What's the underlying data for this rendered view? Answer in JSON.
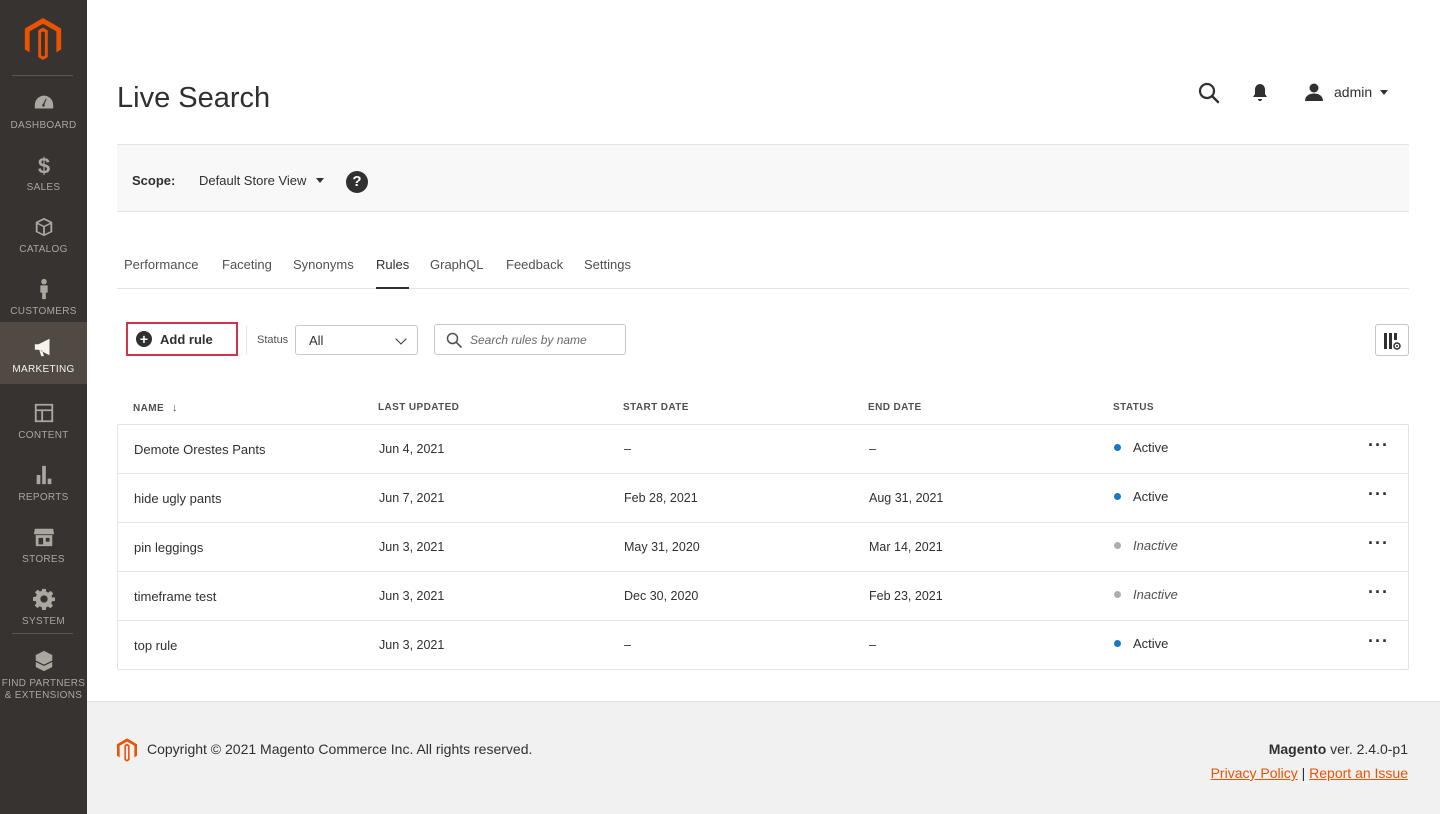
{
  "sidebar": {
    "logo": "magento-logo",
    "items": [
      {
        "label": "DASHBOARD",
        "icon": "dashboard-icon"
      },
      {
        "label": "SALES",
        "icon": "dollar-icon"
      },
      {
        "label": "CATALOG",
        "icon": "box-icon"
      },
      {
        "label": "CUSTOMERS",
        "icon": "person-icon"
      },
      {
        "label": "MARKETING",
        "icon": "megaphone-icon",
        "active": true
      },
      {
        "label": "CONTENT",
        "icon": "layout-icon"
      },
      {
        "label": "REPORTS",
        "icon": "bar-chart-icon"
      },
      {
        "label": "STORES",
        "icon": "storefront-icon"
      },
      {
        "label": "SYSTEM",
        "icon": "gear-icon"
      },
      {
        "label": "FIND PARTNERS",
        "label2": "& EXTENSIONS",
        "icon": "extensions-icon"
      }
    ]
  },
  "header": {
    "title": "Live Search",
    "user": "admin"
  },
  "scope": {
    "label": "Scope:",
    "value": "Default Store View",
    "help": "?"
  },
  "tabs": [
    {
      "label": "Performance"
    },
    {
      "label": "Faceting"
    },
    {
      "label": "Synonyms"
    },
    {
      "label": "Rules",
      "active": true
    },
    {
      "label": "GraphQL"
    },
    {
      "label": "Feedback"
    },
    {
      "label": "Settings"
    }
  ],
  "toolbar": {
    "add_rule": "Add rule",
    "status_label": "Status",
    "status_value": "All",
    "search_placeholder": "Search rules by name"
  },
  "table": {
    "columns": [
      "NAME",
      "LAST UPDATED",
      "START DATE",
      "END DATE",
      "STATUS"
    ],
    "rows": [
      {
        "name": "Demote Orestes Pants",
        "updated": "Jun 4, 2021",
        "start": "–",
        "end": "–",
        "status": "Active"
      },
      {
        "name": "hide ugly pants",
        "updated": "Jun 7, 2021",
        "start": "Feb 28, 2021",
        "end": "Aug 31, 2021",
        "status": "Active"
      },
      {
        "name": "pin leggings",
        "updated": "Jun 3, 2021",
        "start": "May 31, 2020",
        "end": "Mar 14, 2021",
        "status": "Inactive"
      },
      {
        "name": "timeframe test",
        "updated": "Jun 3, 2021",
        "start": "Dec 30, 2020",
        "end": "Feb 23, 2021",
        "status": "Inactive"
      },
      {
        "name": "top rule",
        "updated": "Jun 3, 2021",
        "start": "–",
        "end": "–",
        "status": "Active"
      }
    ]
  },
  "footer": {
    "copyright": "Copyright © 2021 Magento Commerce Inc. All rights reserved.",
    "brand": "Magento",
    "version": " ver. 2.4.0-p1",
    "privacy": "Privacy Policy",
    "separator": "|",
    "report": "Report an Issue"
  },
  "colors": {
    "accent": "#eb5202",
    "active_dot": "#1979c3",
    "inactive_dot": "#adadad",
    "highlight_border": "#d0334c"
  }
}
